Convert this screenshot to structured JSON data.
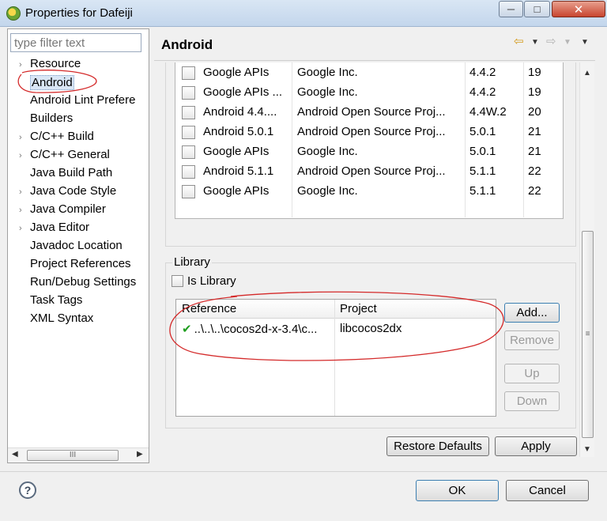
{
  "window": {
    "title": "Properties for Dafeiji",
    "min_glyph": "─",
    "max_glyph": "□",
    "close_glyph": "✕"
  },
  "sidebar": {
    "filter_placeholder": "type filter text",
    "items": [
      {
        "label": "Resource",
        "arrow": "›"
      },
      {
        "label": "Android",
        "arrow": ""
      },
      {
        "label": "Android Lint Prefere",
        "arrow": ""
      },
      {
        "label": "Builders",
        "arrow": ""
      },
      {
        "label": "C/C++ Build",
        "arrow": "›"
      },
      {
        "label": "C/C++ General",
        "arrow": "›"
      },
      {
        "label": "Java Build Path",
        "arrow": ""
      },
      {
        "label": "Java Code Style",
        "arrow": "›"
      },
      {
        "label": "Java Compiler",
        "arrow": "›"
      },
      {
        "label": "Java Editor",
        "arrow": "›"
      },
      {
        "label": "Javadoc Location",
        "arrow": ""
      },
      {
        "label": "Project References",
        "arrow": ""
      },
      {
        "label": "Run/Debug Settings",
        "arrow": ""
      },
      {
        "label": "Task Tags",
        "arrow": ""
      },
      {
        "label": "XML Syntax",
        "arrow": ""
      }
    ],
    "hscroll": {
      "left": "◀",
      "right": "▶",
      "grip": "III"
    }
  },
  "header": {
    "title": "Android",
    "back_icon": "⇦",
    "dropdown_icon": "▼",
    "forward_icon": "⇨",
    "menu_icon": "▼"
  },
  "targets": [
    {
      "name": "Google APIs",
      "vendor": "Google Inc.",
      "platform": "4.4.2",
      "api": "19"
    },
    {
      "name": "Google APIs ...",
      "vendor": "Google Inc.",
      "platform": "4.4.2",
      "api": "19"
    },
    {
      "name": "Android 4.4....",
      "vendor": "Android Open Source Proj...",
      "platform": "4.4W.2",
      "api": "20"
    },
    {
      "name": "Android 5.0.1",
      "vendor": "Android Open Source Proj...",
      "platform": "5.0.1",
      "api": "21"
    },
    {
      "name": "Google APIs",
      "vendor": "Google Inc.",
      "platform": "5.0.1",
      "api": "21"
    },
    {
      "name": "Android 5.1.1",
      "vendor": "Android Open Source Proj...",
      "platform": "5.1.1",
      "api": "22"
    },
    {
      "name": "Google APIs",
      "vendor": "Google Inc.",
      "platform": "5.1.1",
      "api": "22"
    }
  ],
  "library": {
    "group_label": "Library",
    "is_library_label": "Is Library",
    "is_library_checked": false,
    "columns": {
      "reference": "Reference",
      "project": "Project"
    },
    "rows": [
      {
        "check": "✔",
        "reference": "..\\..\\..\\cocos2d-x-3.4\\c...",
        "project": "libcocos2dx"
      }
    ],
    "buttons": {
      "add": "Add...",
      "remove": "Remove",
      "up": "Up",
      "down": "Down"
    }
  },
  "vscroll": {
    "up": "▲",
    "down": "▼",
    "grip": "≡"
  },
  "actions": {
    "restore_defaults": "Restore Defaults",
    "apply": "Apply"
  },
  "footer": {
    "help": "?",
    "ok": "OK",
    "cancel": "Cancel"
  },
  "colors": {
    "annotation_red": "#d42a2a",
    "selection_bg": "#d9e6f5"
  }
}
